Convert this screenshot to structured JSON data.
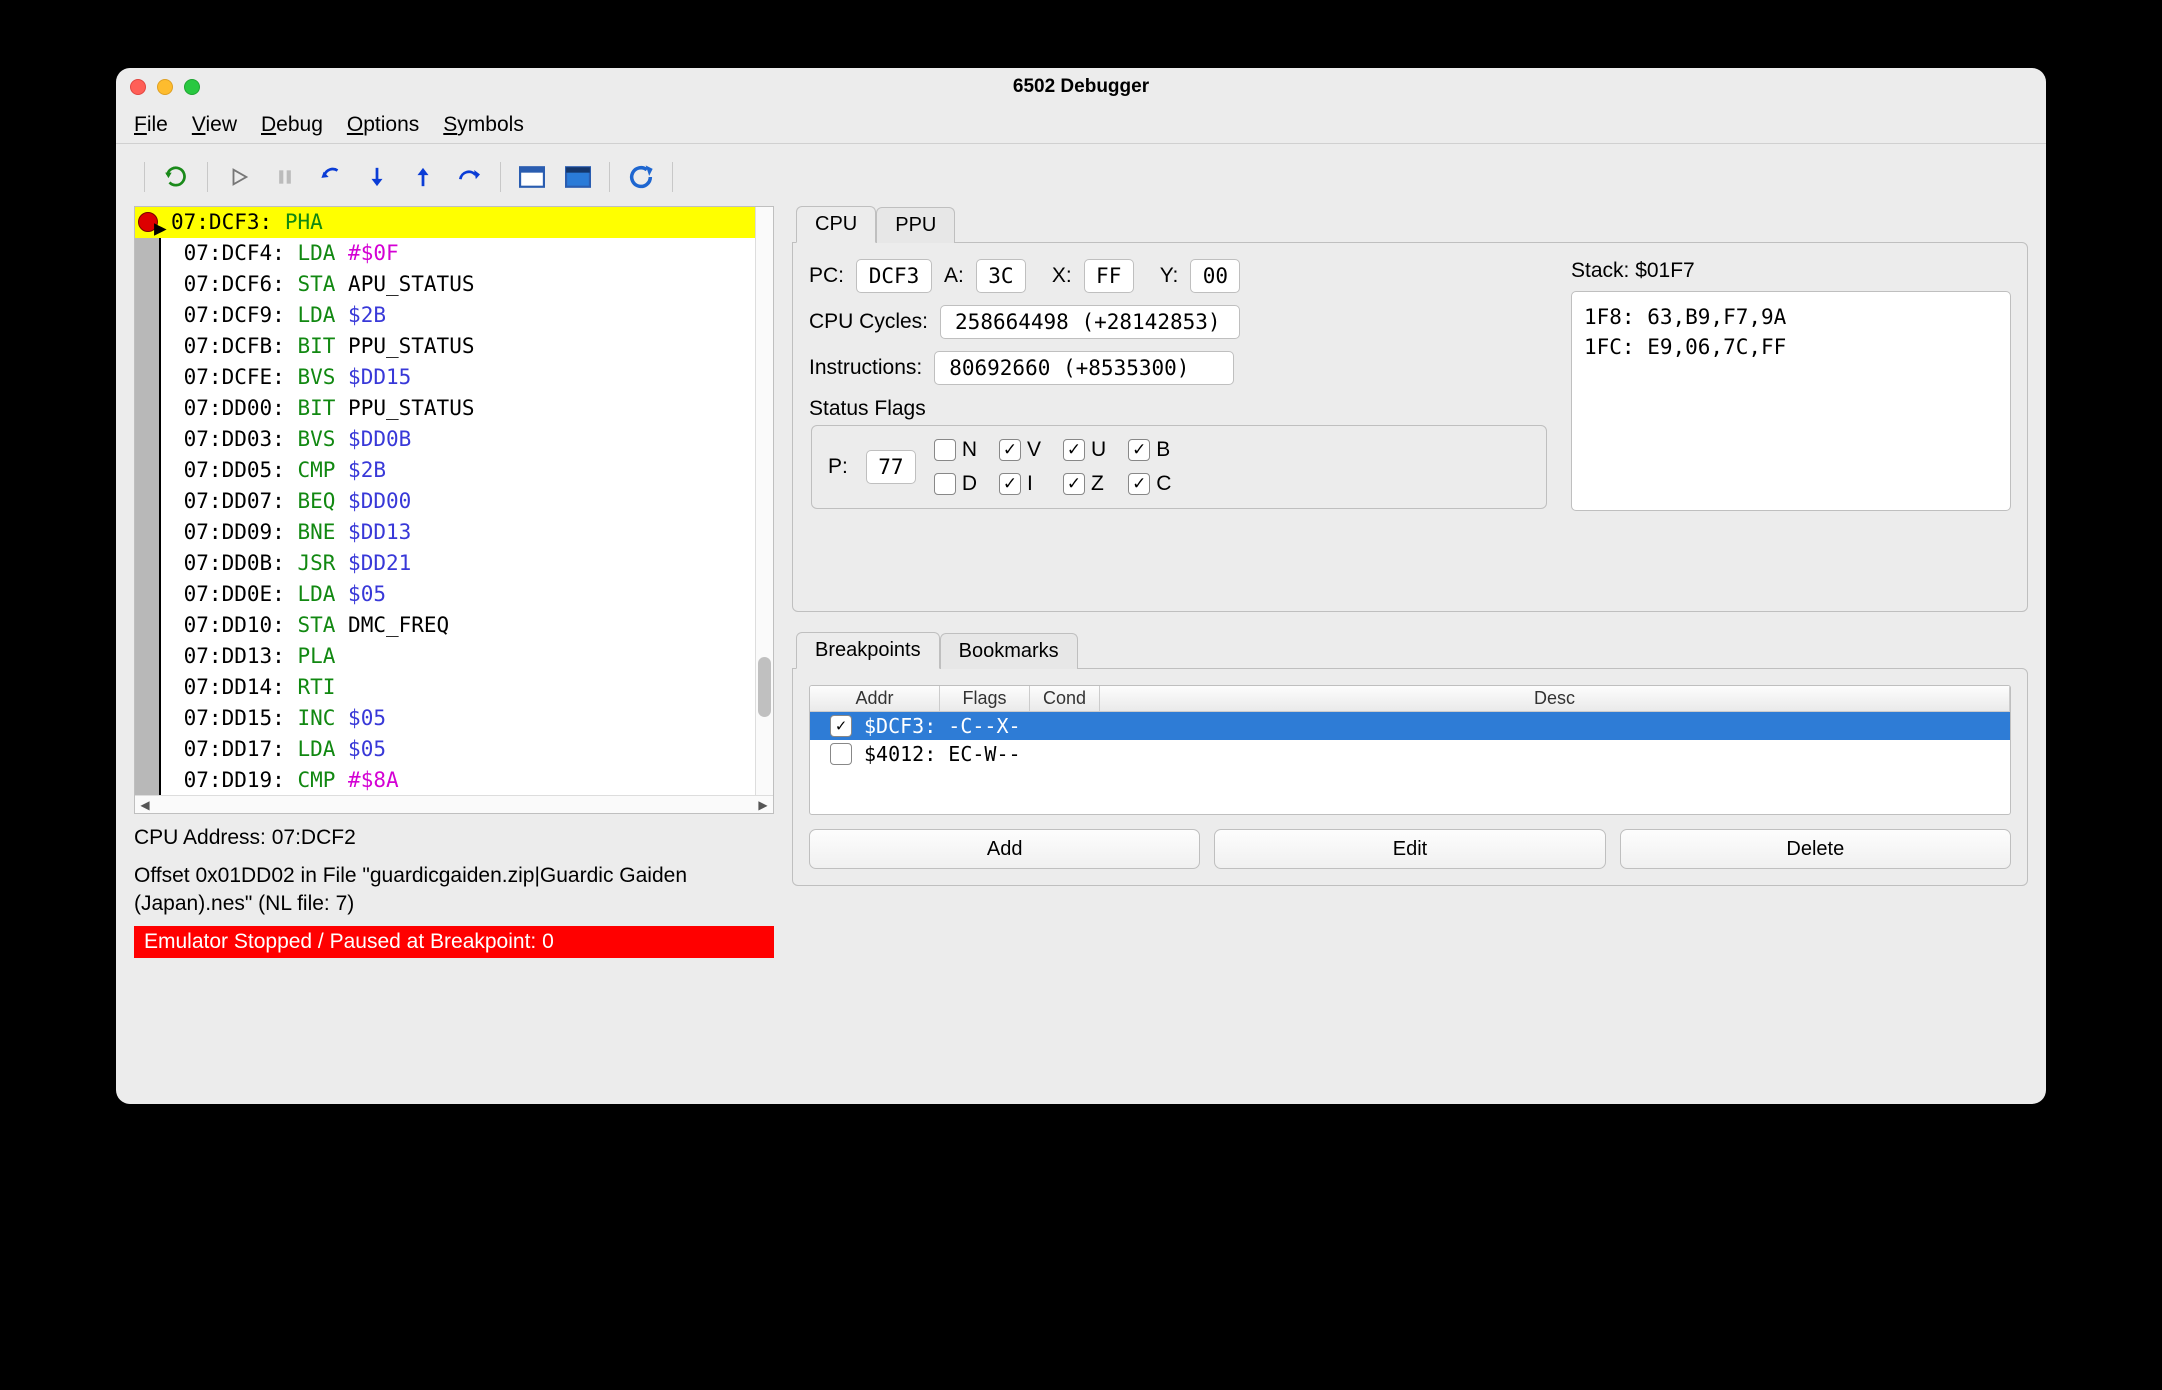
{
  "window": {
    "title": "6502 Debugger"
  },
  "menu": {
    "file": "File",
    "view": "View",
    "debug": "Debug",
    "options": "Options",
    "symbols": "Symbols"
  },
  "toolbar_icons": [
    "reload",
    "run",
    "pause",
    "step-back",
    "step-into",
    "step-out",
    "step-over",
    "window1",
    "window2",
    "refresh"
  ],
  "disasm": {
    "lines": [
      {
        "addr": "07:DCF3:",
        "mnem": "PHA",
        "arg": "",
        "argcls": "",
        "current": true,
        "bp": true
      },
      {
        "addr": "07:DCF4:",
        "mnem": "LDA",
        "arg": "#$0F",
        "argcls": "imm"
      },
      {
        "addr": "07:DCF6:",
        "mnem": "STA",
        "arg": "APU_STATUS",
        "argcls": "sym"
      },
      {
        "addr": "07:DCF9:",
        "mnem": "LDA",
        "arg": "$2B",
        "argcls": "tgt"
      },
      {
        "addr": "07:DCFB:",
        "mnem": "BIT",
        "arg": "PPU_STATUS",
        "argcls": "sym"
      },
      {
        "addr": "07:DCFE:",
        "mnem": "BVS",
        "arg": "$DD15",
        "argcls": "tgt"
      },
      {
        "addr": "07:DD00:",
        "mnem": "BIT",
        "arg": "PPU_STATUS",
        "argcls": "sym"
      },
      {
        "addr": "07:DD03:",
        "mnem": "BVS",
        "arg": "$DD0B",
        "argcls": "tgt"
      },
      {
        "addr": "07:DD05:",
        "mnem": "CMP",
        "arg": "$2B",
        "argcls": "tgt"
      },
      {
        "addr": "07:DD07:",
        "mnem": "BEQ",
        "arg": "$DD00",
        "argcls": "tgt"
      },
      {
        "addr": "07:DD09:",
        "mnem": "BNE",
        "arg": "$DD13",
        "argcls": "tgt"
      },
      {
        "addr": "07:DD0B:",
        "mnem": "JSR",
        "arg": "$DD21",
        "argcls": "tgt"
      },
      {
        "addr": "07:DD0E:",
        "mnem": "LDA",
        "arg": "$05",
        "argcls": "tgt"
      },
      {
        "addr": "07:DD10:",
        "mnem": "STA",
        "arg": "DMC_FREQ",
        "argcls": "sym"
      },
      {
        "addr": "07:DD13:",
        "mnem": "PLA",
        "arg": "",
        "argcls": ""
      },
      {
        "addr": "07:DD14:",
        "mnem": "RTI",
        "arg": "",
        "argcls": ""
      },
      {
        "addr": "07:DD15:",
        "mnem": "INC",
        "arg": "$05",
        "argcls": "tgt"
      },
      {
        "addr": "07:DD17:",
        "mnem": "LDA",
        "arg": "$05",
        "argcls": "tgt"
      },
      {
        "addr": "07:DD19:",
        "mnem": "CMP",
        "arg": "#$8A",
        "argcls": "imm"
      }
    ]
  },
  "info": {
    "cpu_addr_label": "CPU Address: 07:DCF2",
    "offset_line": "Offset 0x01DD02 in File \"guardicgaiden.zip|Guardic Gaiden (Japan).nes\" (NL file: 7)",
    "status": "Emulator Stopped / Paused at Breakpoint: 0"
  },
  "cpu": {
    "tabs": {
      "cpu": "CPU",
      "ppu": "PPU"
    },
    "pc_label": "PC:",
    "pc": "DCF3",
    "a_label": "A:",
    "a": "3C",
    "x_label": "X:",
    "x": "FF",
    "y_label": "Y:",
    "y": "00",
    "cycles_label": "CPU Cycles:",
    "cycles": "258664498  (+28142853)",
    "instr_label": "Instructions:",
    "instr": "80692660  (+8535300)",
    "flags_title": "Status Flags",
    "p_label": "P:",
    "p": "77",
    "flags": {
      "N": false,
      "V": true,
      "U": true,
      "B": true,
      "D": false,
      "I": true,
      "Z": true,
      "C": true
    },
    "stack_label": "Stack: $01F7",
    "stack_lines": [
      "1F8: 63,B9,F7,9A",
      "1FC: E9,06,7C,FF"
    ]
  },
  "bp": {
    "tabs": {
      "breakpoints": "Breakpoints",
      "bookmarks": "Bookmarks"
    },
    "headers": {
      "addr": "Addr",
      "flags": "Flags",
      "cond": "Cond",
      "desc": "Desc"
    },
    "rows": [
      {
        "checked": true,
        "text": "$DCF3: -C--X-",
        "selected": true
      },
      {
        "checked": false,
        "text": "$4012: EC-W--",
        "selected": false
      }
    ],
    "buttons": {
      "add": "Add",
      "edit": "Edit",
      "delete": "Delete"
    }
  }
}
